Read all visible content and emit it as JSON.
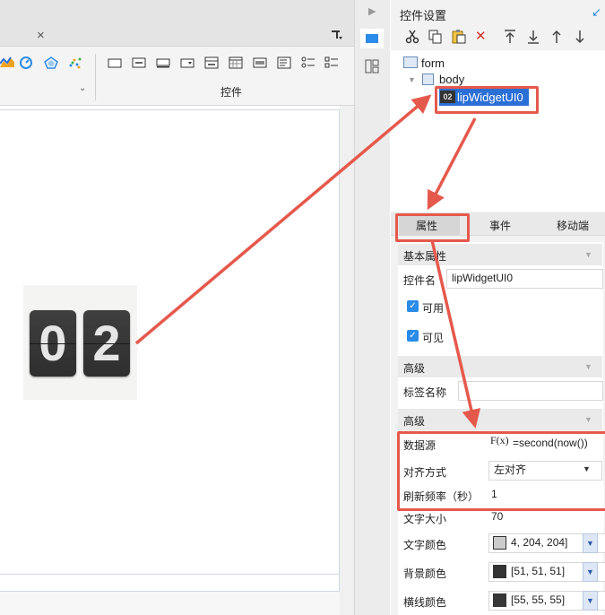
{
  "editor": {
    "close_glyph": "×",
    "toolbar_group_label": "控件"
  },
  "widget_preview": {
    "digits": [
      "0",
      "2"
    ]
  },
  "panel": {
    "title": "控件设置",
    "tree": {
      "root": "form",
      "child": "body",
      "selected_node_icon": "02",
      "selected_node": "lipWidgetUI0"
    },
    "tabs": [
      "属性",
      "事件",
      "移动端"
    ],
    "active_tab": "属性"
  },
  "properties": {
    "basic_section": "基本属性",
    "widget_name_label": "控件名",
    "widget_name_value": "lipWidgetUI0",
    "enabled_label": "可用",
    "visible_label": "可见",
    "advanced_section_1": "高级",
    "tag_name_label": "标签名称",
    "tag_name_value": "",
    "advanced_section_2": "高级",
    "datasource_label": "数据源",
    "formula_icon": "F(x)",
    "datasource_value": "=second(now())",
    "align_label": "对齐方式",
    "align_value": "左对齐",
    "refresh_label": "刷新频率（秒）",
    "refresh_value": "1",
    "font_size_label": "文字大小",
    "font_size_value": "70",
    "text_color_label": "文字颜色",
    "text_color_value": "4, 204, 204]",
    "bg_color_label": "背景颜色",
    "bg_color_value": "[51, 51, 51]",
    "line_color_label": "横线颜色",
    "line_color_value": "[55, 55, 55]"
  },
  "colors": {
    "accent": "#2a8be8",
    "selection": "#2a6fd6",
    "annotation": "#e5594c",
    "text_swatch": "#cccccc",
    "bg_swatch": "#333333",
    "line_swatch": "#373737"
  }
}
